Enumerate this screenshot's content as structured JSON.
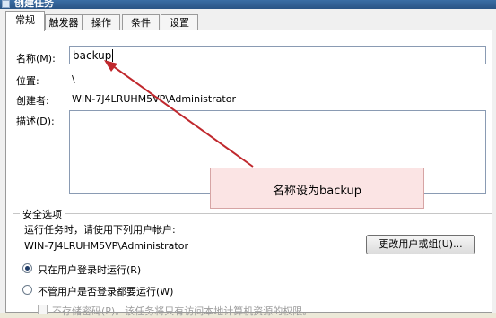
{
  "window": {
    "title": "创建任务"
  },
  "tabs": [
    "常规",
    "触发器",
    "操作",
    "条件",
    "设置"
  ],
  "general": {
    "name_label": "名称(M):",
    "name_value": "backup",
    "location_label": "位置:",
    "location_value": "\\",
    "author_label": "创建者:",
    "author_value": "WIN-7J4LRUHM5VP\\Administrator",
    "description_label": "描述(D):"
  },
  "annotation": {
    "text": "名称设为backup",
    "color": "#c0282d"
  },
  "security": {
    "group_title": "安全选项",
    "run_as_label": "运行任务时，请使用下列用户帐户:",
    "run_as_value": "WIN-7J4LRUHM5VP\\Administrator",
    "change_button": "更改用户或组(U)...",
    "option_logged_on": "只在用户登录时运行(R)",
    "option_whether": "不管用户是否登录都要运行(W)",
    "option_no_password": "不存储密码(P)。该任务将只有访问本地计算机资源的权限。"
  }
}
